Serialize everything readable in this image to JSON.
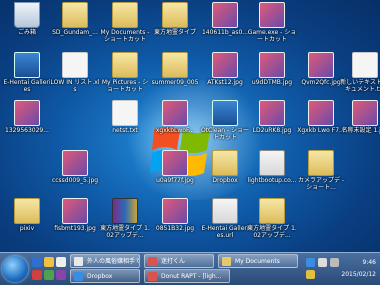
{
  "desktop": {
    "icons": [
      {
        "label": "ごみ箱",
        "type": "trash",
        "icon": "recycle-bin-icon"
      },
      {
        "label": "SD_Gundam_...",
        "type": "folder",
        "icon": "folder-icon"
      },
      {
        "label": "My Documents - ショートカット",
        "type": "folder",
        "icon": "folder-shortcut-icon"
      },
      {
        "label": "東方地霊タイプ",
        "type": "folder",
        "icon": "folder-icon"
      },
      {
        "label": "140611b_as0...",
        "type": "img",
        "icon": "image-icon"
      },
      {
        "label": "Game.exe - ショートカット",
        "type": "img",
        "icon": "image-icon"
      },
      {
        "label": "E-Hentai Galleries",
        "type": "app",
        "icon": "app-icon"
      },
      {
        "label": "LOW IN リスト.xls",
        "type": "doc",
        "icon": "spreadsheet-icon"
      },
      {
        "label": "My Pictures - ショートカット",
        "type": "folder",
        "icon": "folder-shortcut-icon"
      },
      {
        "label": "summer09_005",
        "type": "folder",
        "icon": "folder-icon"
      },
      {
        "label": "ATKst12.jpg",
        "type": "img",
        "icon": "image-icon"
      },
      {
        "label": "u9dDTMB.jpg",
        "type": "img",
        "icon": "image-icon"
      },
      {
        "label": "Qvm2Qfc.jpg",
        "type": "img",
        "icon": "image-icon"
      },
      {
        "label": "新しいテキスト ドキュメント.txt",
        "type": "doc",
        "icon": "text-file-icon"
      },
      {
        "label": "1329563029...",
        "type": "img",
        "icon": "image-icon"
      },
      {
        "label": "netst.txt",
        "type": "doc",
        "icon": "text-file-icon"
      },
      {
        "label": "xgxkbLwoF...",
        "type": "img",
        "icon": "image-icon"
      },
      {
        "label": "OtClean - ショートカット",
        "type": "app",
        "icon": "app-shortcut-icon"
      },
      {
        "label": "LD2uRK8.jpg",
        "type": "img",
        "icon": "image-icon"
      },
      {
        "label": "Xgxkb Lwo F7...",
        "type": "img",
        "icon": "image-icon"
      },
      {
        "label": "名称未設定 1.jpg",
        "type": "img",
        "icon": "image-icon"
      },
      {
        "label": "ccssd009_5.jpg",
        "type": "img",
        "icon": "image-icon"
      },
      {
        "label": "u0a9f77f.jpg",
        "type": "img",
        "icon": "image-icon"
      },
      {
        "label": "Dropbox",
        "type": "folder",
        "icon": "dropbox-icon"
      },
      {
        "label": "lightbootup.co...",
        "type": "web",
        "icon": "web-icon"
      },
      {
        "label": "カメラアップデ - ショート...",
        "type": "folder",
        "icon": "folder-shortcut-icon"
      },
      {
        "label": "pixiv",
        "type": "folder",
        "icon": "folder-icon"
      },
      {
        "label": "fisbmt193.jpg",
        "type": "img",
        "icon": "image-icon"
      },
      {
        "label": "東方地霊タイプ 1.02アップデ...",
        "type": "rar",
        "icon": "archive-icon"
      },
      {
        "label": "0851B32.jpg",
        "type": "img",
        "icon": "image-icon"
      },
      {
        "label": "E-Hentai Galleries.url",
        "type": "web",
        "icon": "web-icon"
      },
      {
        "label": "東方地霊タイプ 1.02アップデ...",
        "type": "folder",
        "icon": "folder-icon"
      }
    ]
  },
  "taskbar": {
    "buttons": [
      {
        "label": "外人の風俗嬢相手で...",
        "color": "#e8e8e8"
      },
      {
        "label": "迷打くん",
        "color": "#d9534f"
      },
      {
        "label": "My Documents",
        "color": "#e6c86a"
      },
      {
        "label": "Dropbox",
        "color": "#3a8de0"
      },
      {
        "label": "Donut RAPT - [ligh...",
        "color": "#d9534f"
      }
    ],
    "time": "9:46",
    "date": "2015/02/12"
  }
}
